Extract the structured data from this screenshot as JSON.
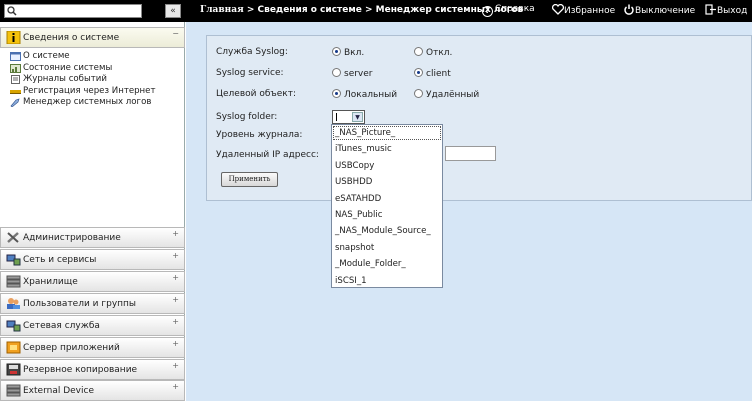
{
  "search": {
    "value": "",
    "collapse_label": "«"
  },
  "sidebar": {
    "system_info": {
      "label": "Сведения о системе",
      "toggle": "−"
    },
    "sub_items": [
      {
        "label": "О системе",
        "icon": "info-window-icon"
      },
      {
        "label": "Состояние системы",
        "icon": "system-status-icon"
      },
      {
        "label": "Журналы событий",
        "icon": "event-log-icon"
      },
      {
        "label": "Регистрация через Интернет",
        "icon": "online-register-icon"
      },
      {
        "label": "Менеджер системных логов",
        "icon": "syslog-manager-icon"
      }
    ],
    "sections": [
      {
        "label": "Администрирование",
        "icon": "admin-tools-icon",
        "toggle": "+"
      },
      {
        "label": "Сеть и сервисы",
        "icon": "network-icon",
        "toggle": "+"
      },
      {
        "label": "Хранилище",
        "icon": "storage-icon",
        "toggle": "+"
      },
      {
        "label": "Пользователи и группы",
        "icon": "users-icon",
        "toggle": "+"
      },
      {
        "label": "Сетевая служба",
        "icon": "network-service-icon",
        "toggle": "+"
      },
      {
        "label": "Сервер приложений",
        "icon": "app-server-icon",
        "toggle": "+"
      },
      {
        "label": "Резервное копирование",
        "icon": "backup-icon",
        "toggle": "+"
      },
      {
        "label": "External Device",
        "icon": "external-device-icon",
        "toggle": "+"
      }
    ]
  },
  "header": {
    "breadcrumb_home": "Главная",
    "breadcrumb_sep1": " > ",
    "breadcrumb_mid": "Сведения о системе",
    "breadcrumb_sep2": " > ",
    "breadcrumb_current": "Менеджер системных логов",
    "help": "Справка",
    "favorites": "Избранное",
    "shutdown": "Выключение",
    "logout": "Выход"
  },
  "form": {
    "syslog_service_ru": {
      "label": "Служба Syslog:",
      "opt_on": "Вкл.",
      "opt_off": "Откл.",
      "selected": "Вкл."
    },
    "syslog_service": {
      "label": "Syslog service:",
      "opt_server": "server",
      "opt_client": "client",
      "selected": "client"
    },
    "target": {
      "label": "Целевой объект:",
      "opt_local": "Локальный",
      "opt_remote": "Удалённый",
      "selected": "Локальный"
    },
    "folder": {
      "label": "Syslog folder:",
      "value": ""
    },
    "log_level": {
      "label": "Уровень журнала:"
    },
    "remote_ip": {
      "label": "Удаленный IP адресс:",
      "value": ""
    },
    "apply": "Применить"
  },
  "dropdown": {
    "options": [
      "_NAS_Picture_",
      "iTunes_music",
      "USBCopy",
      "USBHDD",
      "eSATAHDD",
      "NAS_Public",
      "_NAS_Module_Source_",
      "snapshot",
      "_Module_Folder_",
      "iSCSI_1"
    ],
    "highlighted": "_NAS_Picture_"
  },
  "colors": {
    "topbar": "#000000",
    "main_bg": "#d6e6f6",
    "panel_bg": "#e0eaf4",
    "radio_dot": "#163a88"
  }
}
